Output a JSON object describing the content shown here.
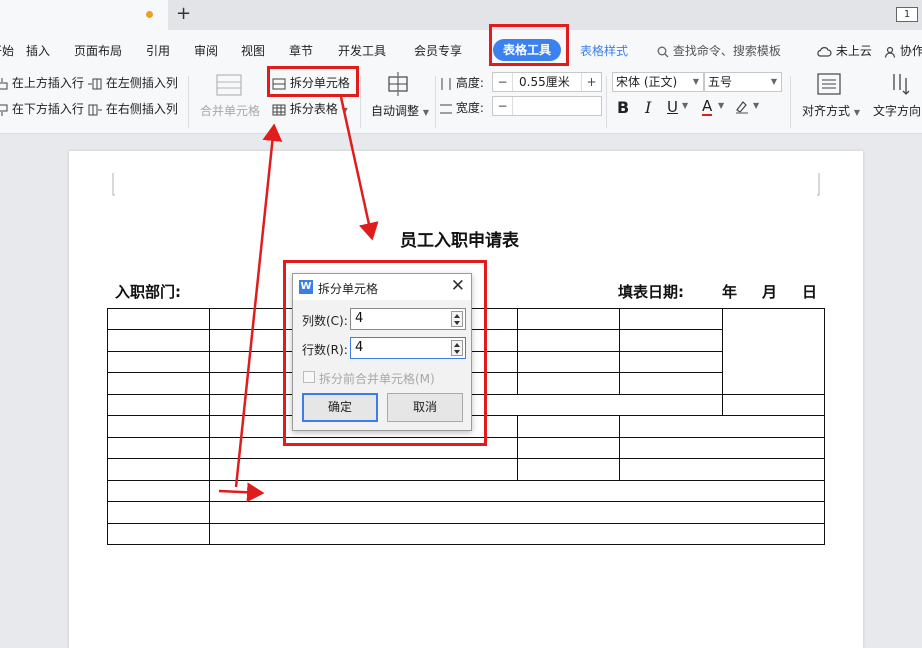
{
  "tabbar": {
    "page_indicator": "1"
  },
  "menubar": {
    "items": [
      "开始",
      "插入",
      "页面布局",
      "引用",
      "审阅",
      "视图",
      "章节",
      "开发工具",
      "会员专享"
    ],
    "active_tab": "表格工具",
    "table_style_tab": "表格样式",
    "search": "查找命令、搜索模板",
    "cloud": "未上云",
    "collab": "协作"
  },
  "ribbon": {
    "insert_above": "在上方插入行",
    "insert_below": "在下方插入行",
    "insert_left": "在左侧插入列",
    "insert_right": "在右侧插入列",
    "merge_cells": "合并单元格",
    "split_cells": "拆分单元格",
    "split_table": "拆分表格",
    "auto_fit": "自动调整",
    "height_label": "高度:",
    "height_value": "0.55厘米",
    "width_label": "宽度:",
    "width_value": "",
    "font_name": "宋体 (正文)",
    "font_size": "五号",
    "align": "对齐方式",
    "text_dir": "文字方向"
  },
  "document": {
    "title": "员工入职申请表",
    "dept_label": "入职部门:",
    "date_label": "填表日期:",
    "year": "年",
    "month": "月",
    "day": "日"
  },
  "dialog": {
    "title": "拆分单元格",
    "cols_label": "列数(C):",
    "cols_value": "4",
    "rows_label": "行数(R):",
    "rows_value": "4",
    "merge_before": "拆分前合并单元格(M)",
    "ok": "确定",
    "cancel": "取消"
  },
  "colors": {
    "accent": "#3b82f0",
    "annotation": "#e01c1c"
  }
}
